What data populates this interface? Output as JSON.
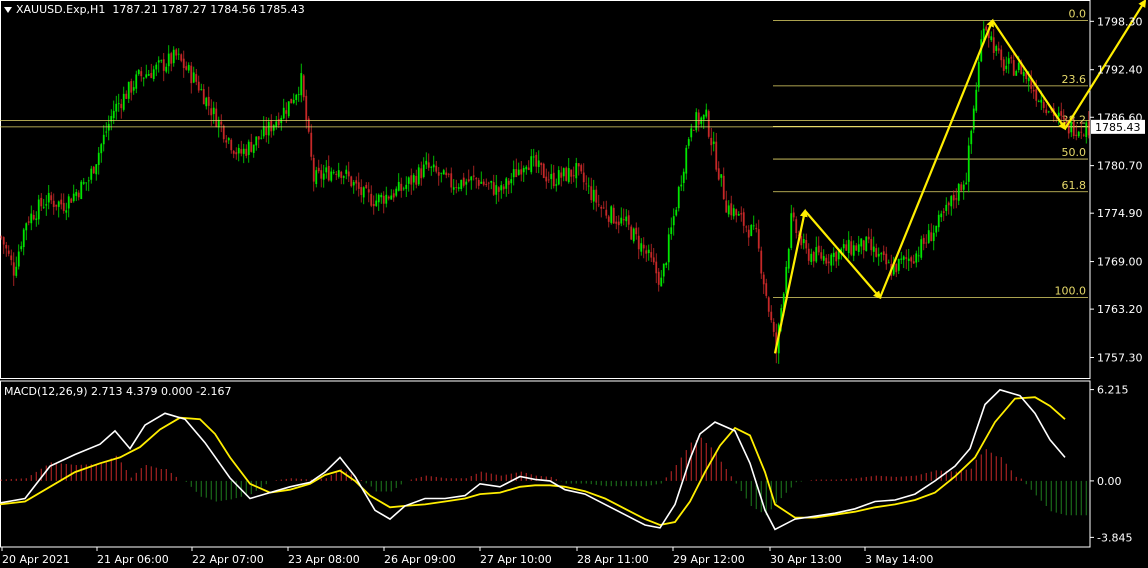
{
  "header": {
    "symbol": "XAUUSD.Exp,H1",
    "ohlc": "1787.21 1787.27 1784.56 1785.43"
  },
  "macd_header": {
    "label": "MACD(12,26,9) 2.713 4.379 0.000 -2.167"
  },
  "colors": {
    "background": "#000000",
    "bull": "#00e600",
    "bear": "#c62828",
    "fib": "#e6d96a",
    "wave": "#ffee00",
    "macd_line": "#ffffff",
    "signal_line": "#ffee00",
    "axis_text": "#ffffff",
    "border": "#ffffff"
  },
  "chart_data": [
    {
      "type": "candlestick",
      "symbol": "XAUUSD.Exp",
      "timeframe": "H1",
      "y_ticks": [
        "1798.30",
        "1792.40",
        "1786.60",
        "1780.70",
        "1774.90",
        "1769.00",
        "1763.20",
        "1757.30"
      ],
      "ylim": [
        1754.8,
        1800.9
      ],
      "current_price": "1785.43",
      "x_ticks": [
        "20 Apr 2021",
        "21 Apr 06:00",
        "22 Apr 07:00",
        "23 Apr 08:00",
        "26 Apr 09:00",
        "27 Apr 10:00",
        "28 Apr 11:00",
        "29 Apr 12:00",
        "30 Apr 13:00",
        "3 May 14:00"
      ],
      "close_path": [
        [
          0,
          1772
        ],
        [
          5,
          1768
        ],
        [
          10,
          1774
        ],
        [
          18,
          1776.5
        ],
        [
          25,
          1776
        ],
        [
          35,
          1779
        ],
        [
          45,
          1787.5
        ],
        [
          55,
          1791.5
        ],
        [
          62,
          1792.5
        ],
        [
          70,
          1794
        ],
        [
          78,
          1791
        ],
        [
          85,
          1787
        ],
        [
          95,
          1782
        ],
        [
          105,
          1784.5
        ],
        [
          115,
          1788.2
        ],
        [
          120,
          1791
        ],
        [
          125,
          1779
        ],
        [
          135,
          1780.5
        ],
        [
          145,
          1777
        ],
        [
          150,
          1776.5
        ],
        [
          160,
          1777.8
        ],
        [
          170,
          1780.5
        ],
        [
          180,
          1778.5
        ],
        [
          190,
          1779
        ],
        [
          200,
          1777.5
        ],
        [
          210,
          1781.5
        ],
        [
          220,
          1779
        ],
        [
          230,
          1780
        ],
        [
          240,
          1775.5
        ],
        [
          250,
          1773.5
        ],
        [
          258,
          1770
        ],
        [
          264,
          1766.5
        ],
        [
          270,
          1776
        ],
        [
          276,
          1786
        ],
        [
          282,
          1786.5
        ],
        [
          290,
          1776
        ],
        [
          296,
          1774
        ],
        [
          302,
          1772
        ],
        [
          310,
          1758
        ],
        [
          316,
          1774
        ],
        [
          322,
          1770
        ],
        [
          330,
          1769.5
        ],
        [
          338,
          1770.5
        ],
        [
          346,
          1771
        ],
        [
          356,
          1768
        ],
        [
          366,
          1770
        ],
        [
          376,
          1774
        ],
        [
          386,
          1779.5
        ],
        [
          393,
          1798.5
        ],
        [
          400,
          1793
        ],
        [
          408,
          1792.5
        ],
        [
          414,
          1789.5
        ],
        [
          420,
          1787.5
        ],
        [
          426,
          1785.4
        ]
      ],
      "fibonacci": {
        "levels": [
          "0.0",
          "23.6",
          "38.2",
          "50.0",
          "61.8",
          "100.0"
        ],
        "high": 1798.4,
        "low": 1764.6
      },
      "wave_path": [
        [
          1757.8,
          310
        ],
        [
          1775.2,
          322
        ],
        [
          1764.6,
          352
        ],
        [
          1798.4,
          397
        ],
        [
          1785.2,
          426
        ],
        [
          1800.8,
          458
        ]
      ],
      "horizontal_lines": [
        1786.2,
        1785.43
      ]
    },
    {
      "type": "line",
      "name": "MACD(12,26,9)",
      "y_ticks": [
        "6.215",
        "0.00",
        "-3.845"
      ],
      "ylim": [
        -4.5,
        6.8
      ],
      "macd_line": [
        [
          0,
          -1.5
        ],
        [
          10,
          -1.2
        ],
        [
          20,
          1.0
        ],
        [
          30,
          1.8
        ],
        [
          40,
          2.5
        ],
        [
          46,
          3.4
        ],
        [
          52,
          2.2
        ],
        [
          58,
          3.8
        ],
        [
          66,
          4.6
        ],
        [
          74,
          4.2
        ],
        [
          82,
          2.6
        ],
        [
          92,
          0.2
        ],
        [
          100,
          -1.2
        ],
        [
          108,
          -0.8
        ],
        [
          116,
          -0.4
        ],
        [
          124,
          -0.1
        ],
        [
          130,
          0.6
        ],
        [
          136,
          1.6
        ],
        [
          142,
          0.3
        ],
        [
          150,
          -2.0
        ],
        [
          156,
          -2.6
        ],
        [
          162,
          -1.7
        ],
        [
          170,
          -1.2
        ],
        [
          178,
          -1.2
        ],
        [
          186,
          -1.0
        ],
        [
          192,
          -0.2
        ],
        [
          200,
          -0.4
        ],
        [
          208,
          0.3
        ],
        [
          214,
          0.1
        ],
        [
          220,
          0.0
        ],
        [
          226,
          -0.6
        ],
        [
          234,
          -0.9
        ],
        [
          242,
          -1.6
        ],
        [
          250,
          -2.3
        ],
        [
          258,
          -3.0
        ],
        [
          264,
          -3.2
        ],
        [
          270,
          -1.6
        ],
        [
          276,
          1.5
        ],
        [
          280,
          3.2
        ],
        [
          286,
          4.0
        ],
        [
          294,
          3.4
        ],
        [
          300,
          1.2
        ],
        [
          306,
          -2.0
        ],
        [
          310,
          -3.3
        ],
        [
          318,
          -2.6
        ],
        [
          326,
          -2.4
        ],
        [
          334,
          -2.2
        ],
        [
          342,
          -1.9
        ],
        [
          350,
          -1.4
        ],
        [
          358,
          -1.3
        ],
        [
          366,
          -0.9
        ],
        [
          374,
          0.0
        ],
        [
          382,
          1.0
        ],
        [
          388,
          2.2
        ],
        [
          394,
          5.2
        ],
        [
          400,
          6.2
        ],
        [
          408,
          5.8
        ],
        [
          414,
          4.6
        ],
        [
          420,
          2.8
        ],
        [
          426,
          1.6
        ]
      ],
      "signal_line": [
        [
          0,
          -1.6
        ],
        [
          10,
          -1.4
        ],
        [
          20,
          -0.4
        ],
        [
          30,
          0.6
        ],
        [
          40,
          1.2
        ],
        [
          48,
          1.6
        ],
        [
          56,
          2.3
        ],
        [
          64,
          3.5
        ],
        [
          72,
          4.3
        ],
        [
          80,
          4.2
        ],
        [
          86,
          3.2
        ],
        [
          92,
          1.6
        ],
        [
          100,
          -0.2
        ],
        [
          108,
          -0.8
        ],
        [
          116,
          -0.6
        ],
        [
          124,
          -0.2
        ],
        [
          130,
          0.4
        ],
        [
          136,
          0.7
        ],
        [
          142,
          0.0
        ],
        [
          148,
          -1.0
        ],
        [
          156,
          -1.8
        ],
        [
          162,
          -1.7
        ],
        [
          170,
          -1.6
        ],
        [
          178,
          -1.4
        ],
        [
          186,
          -1.2
        ],
        [
          192,
          -0.9
        ],
        [
          200,
          -0.8
        ],
        [
          208,
          -0.4
        ],
        [
          214,
          -0.3
        ],
        [
          220,
          -0.3
        ],
        [
          226,
          -0.4
        ],
        [
          234,
          -0.7
        ],
        [
          242,
          -1.2
        ],
        [
          250,
          -1.9
        ],
        [
          258,
          -2.6
        ],
        [
          264,
          -3.0
        ],
        [
          270,
          -2.8
        ],
        [
          276,
          -1.4
        ],
        [
          282,
          0.6
        ],
        [
          288,
          2.4
        ],
        [
          294,
          3.6
        ],
        [
          300,
          3.1
        ],
        [
          306,
          0.6
        ],
        [
          310,
          -1.6
        ],
        [
          318,
          -2.5
        ],
        [
          326,
          -2.5
        ],
        [
          334,
          -2.3
        ],
        [
          342,
          -2.1
        ],
        [
          350,
          -1.8
        ],
        [
          358,
          -1.6
        ],
        [
          366,
          -1.3
        ],
        [
          374,
          -0.8
        ],
        [
          382,
          0.3
        ],
        [
          390,
          1.6
        ],
        [
          398,
          4.0
        ],
        [
          406,
          5.6
        ],
        [
          414,
          5.7
        ],
        [
          420,
          5.1
        ],
        [
          426,
          4.2
        ]
      ]
    }
  ]
}
